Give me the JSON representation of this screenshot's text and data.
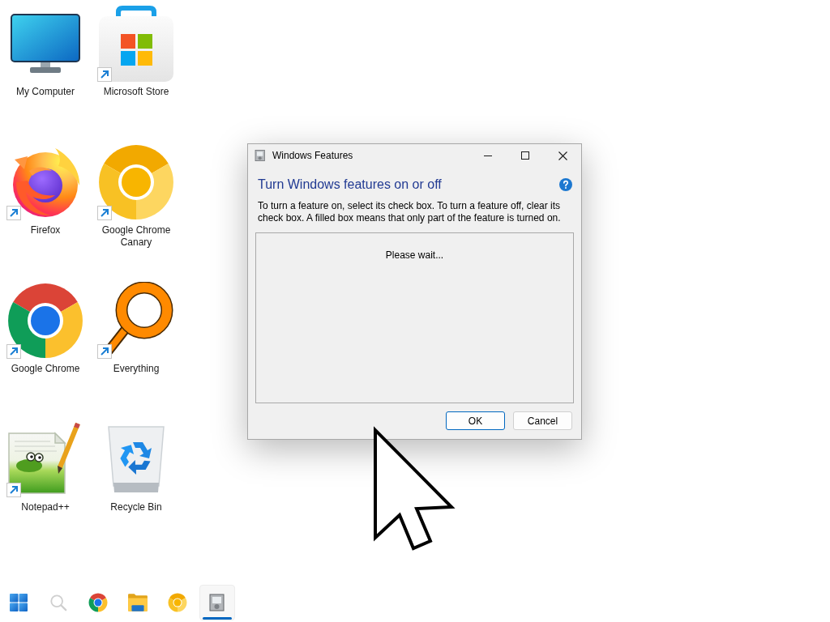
{
  "desktop_icons": [
    {
      "label": "My Computer",
      "kind": "computer",
      "shortcut": false
    },
    {
      "label": "Microsoft Store",
      "kind": "store",
      "shortcut": true
    },
    {
      "label": "Firefox",
      "kind": "firefox",
      "shortcut": true
    },
    {
      "label": "Google Chrome Canary",
      "kind": "canary",
      "shortcut": true
    },
    {
      "label": "Google Chrome",
      "kind": "chrome",
      "shortcut": true
    },
    {
      "label": "Everything",
      "kind": "everything",
      "shortcut": true
    },
    {
      "label": "Notepad++",
      "kind": "notepad",
      "shortcut": true
    },
    {
      "label": "Recycle Bin",
      "kind": "recycle",
      "shortcut": false
    }
  ],
  "dialog": {
    "title": "Windows Features",
    "heading": "Turn Windows features on or off",
    "description": "To turn a feature on, select its check box. To turn a feature off, clear its check box. A filled box means that only part of the feature is turned on.",
    "list_status": "Please wait...",
    "buttons": [
      {
        "label": "OK",
        "default": true
      },
      {
        "label": "Cancel",
        "default": false
      }
    ]
  },
  "taskbar": {
    "items": [
      {
        "kind": "start",
        "selected": false
      },
      {
        "kind": "search",
        "selected": false
      },
      {
        "kind": "chrome",
        "selected": false
      },
      {
        "kind": "folder",
        "selected": false
      },
      {
        "kind": "canary",
        "selected": false
      },
      {
        "kind": "features",
        "selected": true
      }
    ]
  }
}
